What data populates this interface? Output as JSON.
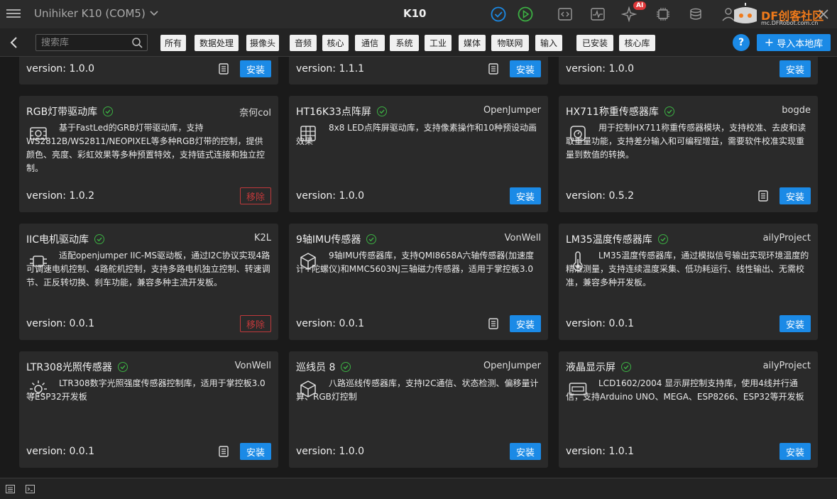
{
  "titlebar": {
    "device": "Unihiker K10 (COM5)",
    "title": "K10",
    "ai_badge": "AI",
    "brand_main": "DF创客社区",
    "brand_url": "mc.DFRobot.com.cn"
  },
  "toolbar": {
    "search_placeholder": "搜索库",
    "tags": [
      "所有",
      "数据处理",
      "摄像头",
      "音频",
      "核心",
      "通信",
      "系统",
      "工业",
      "媒体",
      "物联网",
      "输入",
      "已安装",
      "核心库"
    ],
    "help": "?",
    "import_label": "导入本地库"
  },
  "colors": {
    "accent": "#1b8ae6",
    "remove": "#c0393b",
    "verified": "#3cb043",
    "card_bg": "#2a2a2a"
  },
  "top_row": [
    {
      "version": "version: 1.0.0",
      "has_doc": true,
      "action": "安装"
    },
    {
      "version": "version: 1.1.1",
      "has_doc": true,
      "action": "安装"
    },
    {
      "version": "version: 1.0.0",
      "has_doc": false,
      "action": "安装"
    }
  ],
  "cards": [
    {
      "name": "RGB灯带驱动库",
      "author": "奈何col",
      "icon": "led-strip-icon",
      "desc": "基于FastLed的GRB灯带驱动库，支持WS2812B/WS2811/NEOPIXEL等多种RGB灯带的控制，提供颜色、亮度、彩虹效果等多种预置特效，支持链式连接和独立控制。",
      "version": "version: 1.0.2",
      "has_doc": false,
      "action": "移除"
    },
    {
      "name": "HT16K33点阵屏",
      "author": "OpenJumper",
      "icon": "grid-icon",
      "desc": "8x8 LED点阵屏驱动库，支持像素操作和10种预设动画效果",
      "version": "version: 1.0.0",
      "has_doc": false,
      "action": "安装"
    },
    {
      "name": "HX711称重传感器库",
      "author": "bogde",
      "icon": "scale-icon",
      "desc": "用于控制HX711称重传感器模块，支持校准、去皮和读取重量功能，支持差分输入和可编程增益，需要软件校准实现重量到数值的转换。",
      "version": "version: 0.5.2",
      "has_doc": true,
      "action": "安装"
    },
    {
      "name": "IIC电机驱动库",
      "author": "K2L",
      "icon": "chip-icon",
      "desc": "适配openjumper IIC-MS驱动板，通过I2C协议实现4路可调速电机控制、4路舵机控制，支持多路电机独立控制、转速调节、正反转切换、刹车功能，兼容多种主流开发板。",
      "version": "version: 0.0.1",
      "has_doc": false,
      "action": "移除"
    },
    {
      "name": "9轴IMU传感器",
      "author": "VonWell",
      "icon": "cube-icon",
      "desc": "9轴IMU传感器库，支持QMI8658A六轴传感器(加速度计+陀螺仪)和MMC5603NJ三轴磁力传感器，适用于掌控板3.0",
      "version": "version: 0.0.1",
      "has_doc": true,
      "action": "安装"
    },
    {
      "name": "LM35温度传感器库",
      "author": "ailyProject",
      "icon": "thermometer-icon",
      "desc": "LM35温度传感器库，通过模拟信号输出实现环境温度的精准测量，支持连续温度采集、低功耗运行、线性输出、无需校准，兼容多种开发板。",
      "version": "version: 0.0.1",
      "has_doc": false,
      "action": "安装"
    },
    {
      "name": "LTR308光照传感器",
      "author": "VonWell",
      "icon": "sun-icon",
      "desc": "LTR308数字光照强度传感器控制库，适用于掌控板3.0等ESP32开发板",
      "version": "version: 0.0.1",
      "has_doc": true,
      "action": "安装"
    },
    {
      "name": "巡线员 8",
      "author": "OpenJumper",
      "icon": "cube-icon",
      "desc": "八路巡线传感器库，支持I2C通信、状态检测、偏移量计算、RGB灯控制",
      "version": "version: 1.0.0",
      "has_doc": false,
      "action": "安装"
    },
    {
      "name": "液晶显示屏",
      "author": "ailyProject",
      "icon": "display-icon",
      "desc": "LCD1602/2004 显示屏控制支持库，使用4线并行通信，支持Arduino UNO、MEGA、ESP8266、ESP32等开发板",
      "version": "version: 1.0.1",
      "has_doc": false,
      "action": "安装"
    }
  ]
}
